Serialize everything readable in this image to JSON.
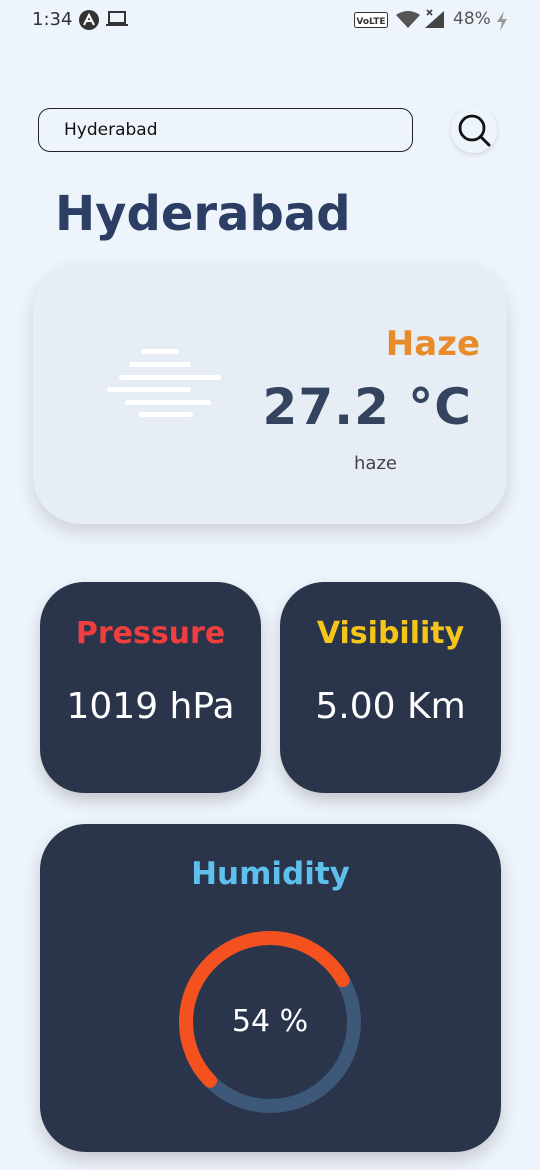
{
  "status_bar": {
    "time": "1:34",
    "network_label": "VoLTE",
    "battery": "48%"
  },
  "search": {
    "value": "Hyderabad"
  },
  "city": "Hyderabad",
  "current": {
    "condition": "Haze",
    "temperature": "27.2 °C",
    "description": "haze",
    "icon": "haze-icon"
  },
  "pressure": {
    "label": "Pressure",
    "value": "1019 hPa"
  },
  "visibility": {
    "label": "Visibility",
    "value": "5.00 Km"
  },
  "humidity": {
    "label": "Humidity",
    "value_text": "54 %",
    "percent": 54
  },
  "colors": {
    "background": "#eef4fb",
    "card_light": "#e6edf5",
    "card_dark": "#2a344b",
    "title": "#2c3e63",
    "condition": "#e88b2b",
    "pressure": "#ef3e3e",
    "visibility": "#f5c518",
    "humidity": "#5fc0ee",
    "gauge_fill": "#f4511e",
    "gauge_track": "#3d5878"
  }
}
